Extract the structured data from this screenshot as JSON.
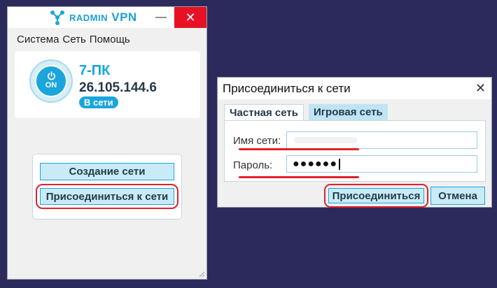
{
  "main_window": {
    "brand": {
      "prefix": "RADMIN",
      "suffix": "VPN",
      "accent_color": "#1aa6dd"
    },
    "controls": {
      "minimize": "—",
      "close": "✕"
    },
    "menu": [
      "Система",
      "Сеть",
      "Помощь"
    ],
    "status": {
      "power_label": "ON",
      "host_name": "7-ПК",
      "ip_address": "26.105.144.6",
      "badge": "В сети"
    },
    "actions": {
      "create_network": "Создание сети",
      "join_network": "Присоединиться к сети"
    }
  },
  "join_dialog": {
    "title": "Присоединиться к сети",
    "close": "✕",
    "tabs": [
      "Частная сеть",
      "Игровая сеть"
    ],
    "fields": {
      "network_name_label": "Имя сети:",
      "network_name_value": "",
      "password_label": "Пароль:",
      "password_value": "●●●●●●"
    },
    "buttons": {
      "connect": "Присоединиться",
      "cancel": "Отмена"
    },
    "highlight_color": "#e3202a"
  }
}
